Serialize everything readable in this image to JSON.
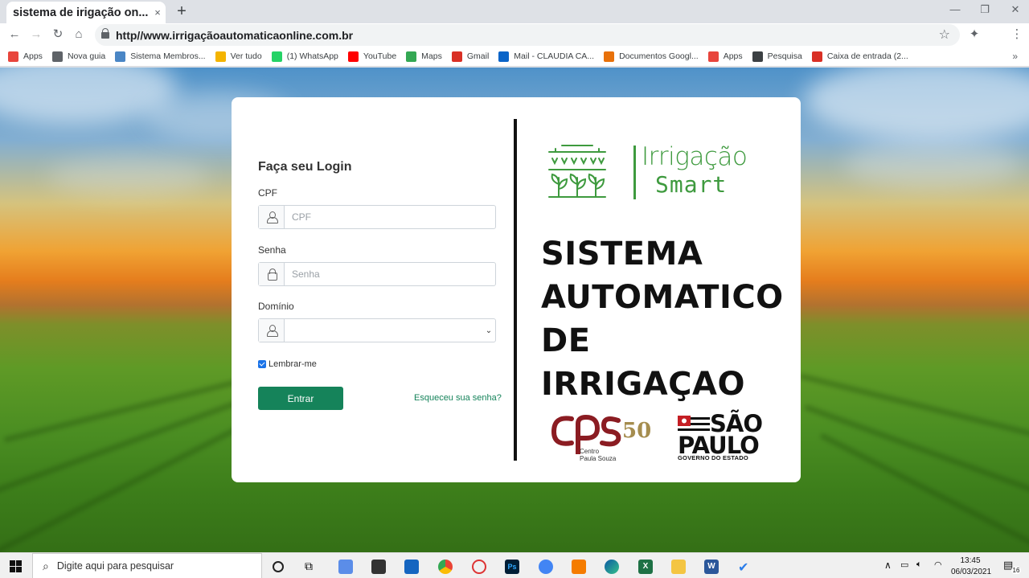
{
  "browser": {
    "tab_title": "sistema de irigação on...",
    "tab_close": "×",
    "new_tab": "+",
    "url": "http//www.irrigaçãoautomaticaonline.com.br",
    "minimize": "—",
    "maximize": "❐",
    "close": "✕"
  },
  "bookmarks": [
    {
      "label": "Apps",
      "color": "#e8453c"
    },
    {
      "label": "Nova guia",
      "color": "#5f6368"
    },
    {
      "label": "Sistema Membros...",
      "color": "#4a86c5"
    },
    {
      "label": "Ver tudo",
      "color": "#f4b400"
    },
    {
      "label": "(1) WhatsApp",
      "color": "#25d366"
    },
    {
      "label": "YouTube",
      "color": "#ff0000"
    },
    {
      "label": "Maps",
      "color": "#34a853"
    },
    {
      "label": "Gmail",
      "color": "#d93025"
    },
    {
      "label": "Mail - CLAUDIA CA...",
      "color": "#0a64c8"
    },
    {
      "label": "Documentos Googl...",
      "color": "#e8710a"
    },
    {
      "label": "Apps",
      "color": "#e8453c"
    },
    {
      "label": "Pesquisa",
      "color": "#3c4043"
    },
    {
      "label": "Caixa de entrada (2...",
      "color": "#d93025"
    }
  ],
  "bookmarks_more": "»",
  "login": {
    "title": "Faça seu Login",
    "cpf_label": "CPF",
    "cpf_placeholder": "CPF",
    "senha_label": "Senha",
    "senha_placeholder": "Senha",
    "dominio_label": "Domínio",
    "dominio_value": "",
    "remember_label": "Lembrar-me",
    "remember_checked": true,
    "submit_label": "Entrar",
    "forgot_label": "Esqueceu sua senha?"
  },
  "brand": {
    "logo_line1": "Irrigação",
    "logo_line2": "Smart",
    "system_line1": "SISTEMA",
    "system_line2": "AUTOMATICO",
    "system_line3": "DE IRRIGAÇAO",
    "cps_sub1": "Centro",
    "cps_sub2": "Paula Souza",
    "fifty": "50",
    "sp_line1": "SÃO",
    "sp_line2": "PAULO",
    "sp_line3": "GOVERNO DO ESTADO",
    "accent": "#3e9a3e",
    "button_color": "#15835a"
  },
  "taskbar": {
    "search_placeholder": "Digite aqui para pesquisar",
    "time": "13:45",
    "date": "06/03/2021",
    "notifications": "16"
  }
}
